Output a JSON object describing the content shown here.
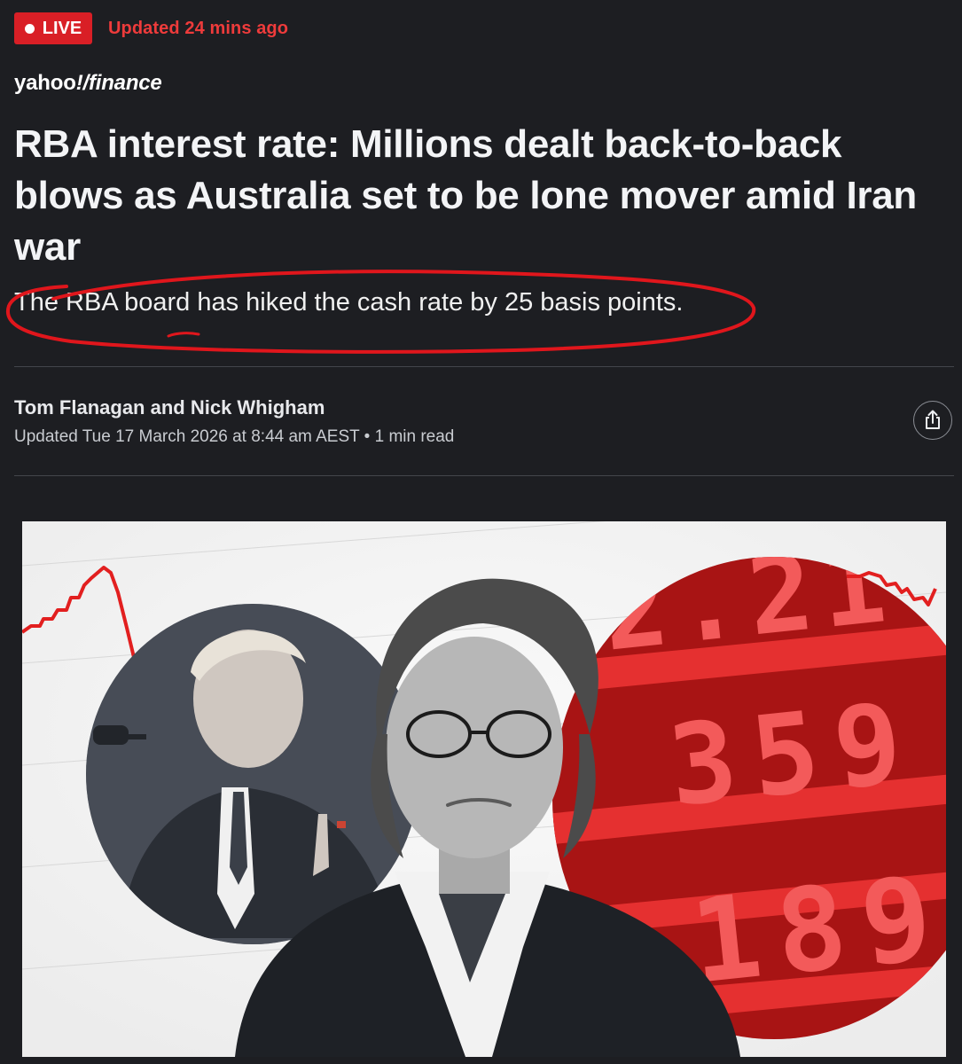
{
  "live": {
    "label": "LIVE",
    "updated": "Updated 24 mins ago"
  },
  "brand": {
    "yahoo": "yahoo",
    "excl": "!",
    "slash": "/",
    "finance": "finance"
  },
  "article": {
    "headline": "RBA interest rate: Millions dealt back-to-back blows as Australia set to be lone mover amid Iran war",
    "subheadline": "The RBA board has hiked the cash rate by 25 basis points.",
    "authors": "Tom Flanagan and Nick Whigham",
    "meta": "Updated Tue 17 March 2026 at 8:44 am AEST • 1 min read"
  },
  "hero": {
    "board_digits": {
      "row1": "2.21",
      "row2": "359",
      "row3": "189"
    }
  },
  "colors": {
    "background": "#1d1e22",
    "live_red": "#d91f26",
    "updated_red": "#ee3b3b",
    "annotation_red": "#e0161c",
    "chart_red": "#e21f1f"
  },
  "icons": {
    "share": "share-icon",
    "live_dot": "live-dot-icon"
  }
}
